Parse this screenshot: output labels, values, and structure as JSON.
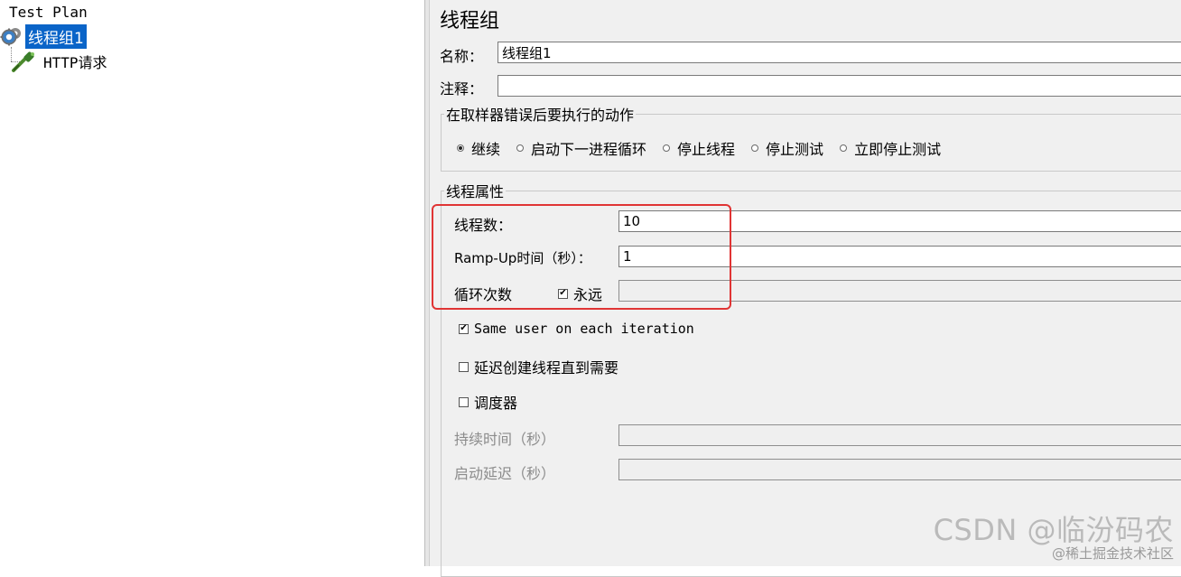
{
  "tree": {
    "root_label": "Test Plan",
    "thread_group_label": "线程组1",
    "http_label": "HTTP请求"
  },
  "panel": {
    "title": "线程组",
    "name_label": "名称：",
    "name_value": "线程组1",
    "comment_label": "注释：",
    "comment_value": "",
    "error_action": {
      "legend": "在取样器错误后要执行的动作",
      "options": [
        "继续",
        "启动下一进程循环",
        "停止线程",
        "停止测试",
        "立即停止测试"
      ],
      "selected": "继续"
    },
    "thread_props": {
      "legend": "线程属性",
      "threads_label": "线程数：",
      "threads_value": "10",
      "rampup_label": "Ramp-Up时间（秒）：",
      "rampup_value": "1",
      "loop_label": "循环次数",
      "forever_label": "永远",
      "forever_checked": true,
      "loop_value": ""
    },
    "same_user_label": "Same user on each iteration",
    "same_user_checked": true,
    "delay_label": "延迟创建线程直到需要",
    "delay_checked": false,
    "scheduler_label": "调度器",
    "scheduler_checked": false,
    "duration_label": "持续时间（秒）",
    "duration_value": "",
    "startup_delay_label": "启动延迟（秒）",
    "startup_delay_value": ""
  },
  "watermark": {
    "main": "CSDN @临汾码农",
    "sub": "@稀土掘金技术社区"
  },
  "colors": {
    "selection": "#0a64c8",
    "highlight_box": "#e03434",
    "panel_bg": "#f0f0f0"
  }
}
